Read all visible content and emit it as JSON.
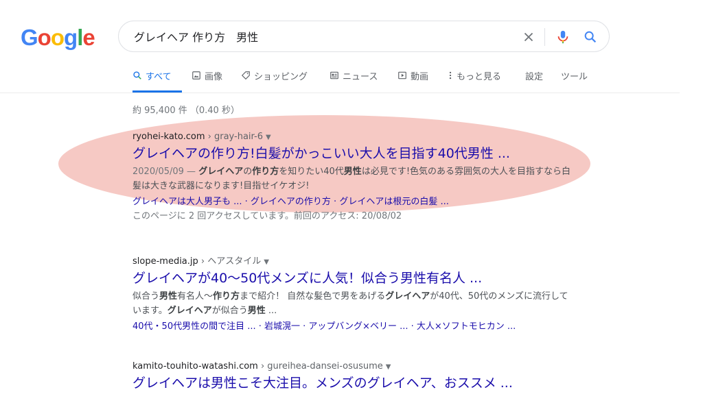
{
  "logo": {
    "letters": [
      "G",
      "o",
      "o",
      "g",
      "l",
      "e"
    ],
    "colors": [
      "#4285f4",
      "#ea4335",
      "#fbbc05",
      "#4285f4",
      "#34a853",
      "#ea4335"
    ]
  },
  "search": {
    "query": "グレイヘア 作り方　男性",
    "placeholder": "",
    "clear_icon": "close-icon",
    "mic_icon": "microphone-icon",
    "search_icon": "search-icon"
  },
  "tabs": [
    {
      "label": "すべて",
      "icon": "search-icon",
      "active": true
    },
    {
      "label": "画像",
      "icon": "image-icon"
    },
    {
      "label": "ショッピング",
      "icon": "tag-icon"
    },
    {
      "label": "ニュース",
      "icon": "news-icon"
    },
    {
      "label": "動画",
      "icon": "play-icon"
    },
    {
      "label": "もっと見る",
      "icon": "more-vert-icon"
    },
    {
      "label": "設定"
    },
    {
      "label": "ツール"
    }
  ],
  "result_stats": "約 95,400 件 （0.40 秒）",
  "results": [
    {
      "domain": "ryohei-kato.com",
      "path": " › gray-hair-6",
      "title": "グレイヘアの作り方!白髪がかっこいい大人を目指す40代男性 ...",
      "date": "2020/05/09 — ",
      "snippet_parts": [
        {
          "t": "グレイヘア",
          "b": true
        },
        {
          "t": "の",
          "b": false
        },
        {
          "t": "作り方",
          "b": true
        },
        {
          "t": "を知りたい40代",
          "b": false
        },
        {
          "t": "男性",
          "b": true
        },
        {
          "t": "は必見です!色気のある雰囲気の大人を目指すなら白髪は大きな武器になります!目指せイケオジ!",
          "b": false
        }
      ],
      "sitelinks": "グレイヘアは大人男子も ... · グレイヘアの作り方 · グレイヘアは根元の白髪 ...",
      "visit_note": "このページに 2 回アクセスしています。前回のアクセス: 20/08/02"
    },
    {
      "domain": "slope-media.jp",
      "path": " › ヘアスタイル",
      "title": "グレイヘアが40〜50代メンズに人気！似合う男性有名人 ...",
      "snippet_parts": [
        {
          "t": "似合う",
          "b": false
        },
        {
          "t": "男性",
          "b": true
        },
        {
          "t": "有名人〜",
          "b": false
        },
        {
          "t": "作り方",
          "b": true
        },
        {
          "t": "まで紹介！ 自然な髪色で男をあげる",
          "b": false
        },
        {
          "t": "グレイヘア",
          "b": true
        },
        {
          "t": "が40代、50代のメンズに流行しています。",
          "b": false
        },
        {
          "t": "グレイヘア",
          "b": true
        },
        {
          "t": "が似合う",
          "b": false
        },
        {
          "t": "男性",
          "b": true
        },
        {
          "t": " ...",
          "b": false
        }
      ],
      "sitelinks": "40代・50代男性の間で注目 ... · 岩城滉一 · アップバング×ベリー ... · 大人×ソフトモヒカン ..."
    },
    {
      "domain": "kamito-touhito-watashi.com",
      "path": " › gureihea-dansei-osusume",
      "title": "グレイヘアは男性こそ大注目。メンズのグレイヘア、おススメ ..."
    }
  ],
  "colors": {
    "link": "#1a0dab",
    "accent": "#1a73e8",
    "highlight": "#f0a8a0"
  }
}
